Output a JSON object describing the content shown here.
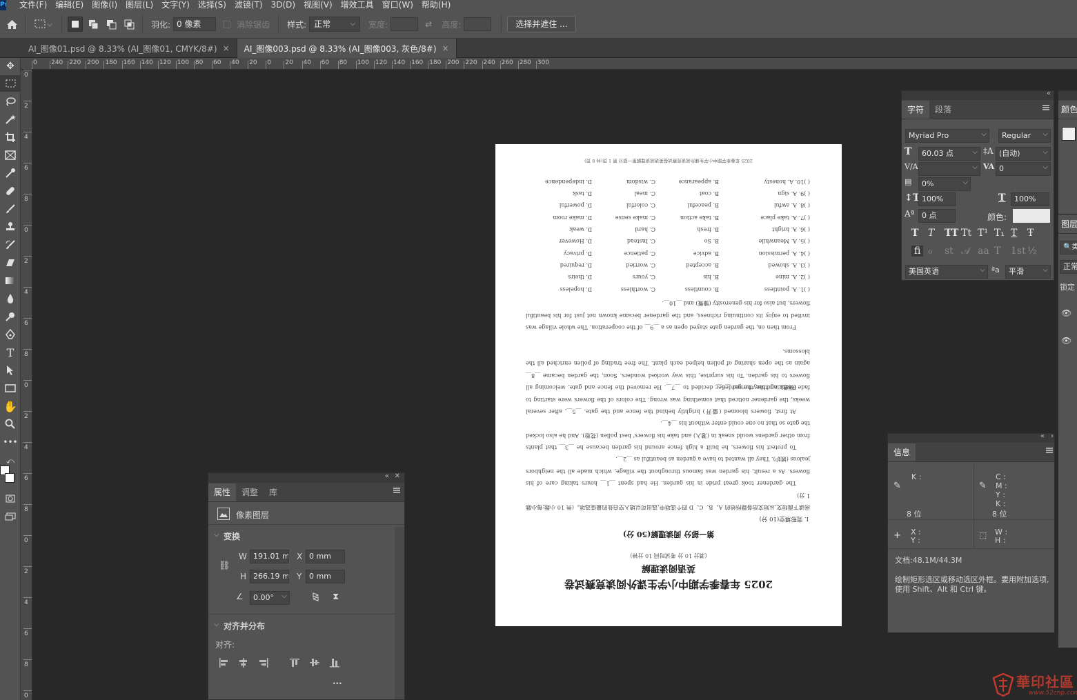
{
  "menubar": {
    "items": [
      "文件(F)",
      "编辑(E)",
      "图像(I)",
      "图层(L)",
      "文字(Y)",
      "选择(S)",
      "滤镜(T)",
      "3D(D)",
      "视图(V)",
      "增效工具",
      "窗口(W)",
      "帮助(H)"
    ]
  },
  "options_bar": {
    "feather_label": "羽化:",
    "feather_value": "0 像素",
    "antialias_label": "消除锯齿",
    "style_label": "样式:",
    "style_value": "正常",
    "width_label": "宽度:",
    "height_label": "高度:",
    "select_mask_button": "选择并遮住 ..."
  },
  "tabs": [
    {
      "label": "AI_图像01.psd @ 8.33% (AI_图像01, CMYK/8#)",
      "close": "×",
      "active": false
    },
    {
      "label": "AI_图像003.psd @ 8.33% (AI_图像003, 灰色/8#)",
      "close": "×",
      "active": true
    }
  ],
  "ruler_top_ticks": [
    "0",
    "240",
    "220",
    "200",
    "180",
    "160",
    "140",
    "120",
    "100",
    "80",
    "60",
    "40",
    "20",
    "0",
    "20",
    "40",
    "60",
    "80",
    "100",
    "120",
    "140",
    "160",
    "180",
    "200",
    "220",
    "240",
    "260",
    "280",
    "300"
  ],
  "ruler_left_ticks": [
    "0",
    "2",
    "4",
    "6",
    "8",
    "0",
    "2",
    "4",
    "6",
    "8",
    "0",
    "2",
    "4",
    "6",
    "8",
    "0",
    "2",
    "4",
    "6",
    "8",
    "0"
  ],
  "document": {
    "title": "2025 年春季学期中小学生课外阅读竞赛试卷",
    "subtitle": "英语阅读理解",
    "note": "(满分 10 分   考试时间 10 分钟)",
    "part": "第一部分   阅读理解(50 分)",
    "section": "I. 完形填空(10 分)",
    "para1": "阅读下面短文,从短文后各题所给的 A、B、C、D 四个选项中,选出可以填入空白处的最佳选项。(共 10 小题;每小题 1 分)",
    "para2": "The gardener took great pride in his garden. He had spent __1__ hours taking care of his flowers. As a result, his garden was famous throughout the village, which made all the neighbors jealous (嫉妒). They all wanted to have a garden as beautiful as __2__.",
    "para3": "To protect his flowers, he built a high fence around his garden because he __3__ that plants from other gardens would sneak in (潜入) and take his flowers' best pollen (花粉). And he also locked the gate so that no one could enter without his __4__.",
    "para4": "At first, flowers bloomed (盛开) brightly behind the fence and the gate. __5__, after several weeks, the gardener noticed that something was wrong. The colors of the flowers were starting to fade (褪色), and they turned __6__.",
    "para5": "Realizing this, the gardener decided to __7__. He removed the fence and gate, welcoming all flowers to his garden. To his surprise, this way worked wonders. Soon, the garden became __8__ again as the open sharing of pollen helped each plant. The free trading of pollen enriched all the blossoms.",
    "para6": "From then on, the garden gate stayed open as a __9__ of the cooperation. The whole village was invited to enjoy its continuing richness, and the gardener became known not just for his beautiful flowers, but also for his generosity (慷慨) and __10__.",
    "options": [
      [
        "( )1. A. pointless",
        "B. countless",
        "C. worthless",
        "D. hopeless"
      ],
      [
        "( )2. A. mine",
        "B. his",
        "C. yours",
        "D. theirs"
      ],
      [
        "( )3. A. showed",
        "B. accepted",
        "C. worried",
        "D. required"
      ],
      [
        "( )4. A. permission",
        "B. advice",
        "C. patience",
        "D. privacy"
      ],
      [
        "( )5. A. Meanwhile",
        "B. So",
        "C. Instead",
        "D. However"
      ],
      [
        "( )6. A. bright",
        "B. fresh",
        "C. hard",
        "D. weak"
      ],
      [
        "( )7. A. take place",
        "B. take action",
        "C. make sense",
        "D. make room"
      ],
      [
        "( )8. A. awful",
        "B. peaceful",
        "C. colorful",
        "D. powerful"
      ],
      [
        "( )9. A. sign",
        "B. coat",
        "C. meal",
        "D. task"
      ],
      [
        "( )10. A. honesty",
        "B. appearance",
        "C. wisdom",
        "D. independence"
      ]
    ],
    "header": "2025 年春季学期中小学生课外阅读竞赛试卷英语阅读理解第一部分   第 1 页(共 8 页)"
  },
  "properties_panel": {
    "tabs": [
      "属性",
      "调整",
      "库"
    ],
    "layer_type": "像素图层",
    "transform_heading": "变换",
    "w_label": "W",
    "w_value": "191.01 mm",
    "h_label": "H",
    "h_value": "266.19 mm",
    "x_label": "X",
    "x_value": "0 mm",
    "y_label": "Y",
    "y_value": "0 mm",
    "angle_value": "0.00°",
    "align_heading": "对齐并分布",
    "align_label": "对齐:",
    "more": "..."
  },
  "character_panel": {
    "tabs": [
      "字符",
      "段落"
    ],
    "font_family": "Myriad Pro",
    "font_style": "Regular",
    "font_size": "60.03 点",
    "leading": "(自动)",
    "tracking": "0",
    "tsume": "0%",
    "vscale": "100%",
    "hscale": "100%",
    "baseline": "0 点",
    "color_label": "颜色:",
    "language": "美国英语",
    "aa_label": "ªa",
    "antialias": "平滑",
    "style_glyphs": [
      "T",
      "T",
      "TT",
      "Tt",
      "T¹",
      "T₁",
      "T",
      "Ŧ"
    ],
    "ot_glyphs": [
      "fi",
      "ℴ",
      "st",
      "𝒜",
      "aa",
      "T",
      "1st",
      "½"
    ]
  },
  "color_panel": {
    "tab": "颜色"
  },
  "layers_panel": {
    "tab": "图层",
    "kind": "类",
    "blend": "正常",
    "lock": "锁定"
  },
  "info_panel": {
    "tab": "信息",
    "k_label": "K :",
    "c_label": "C :",
    "m_label": "M :",
    "y_label": "Y :",
    "k2_label": "K :",
    "bit_left": "8 位",
    "bit_right": "8 位",
    "x_label": "X :",
    "y2_label": "Y :",
    "w_label": "W :",
    "h_label": "H :",
    "doc_size": "文档:48.1M/44.3M",
    "hint": "绘制矩形选区或移动选区外框。要用附加选项,使用 Shift、Alt 和 Ctrl 键。"
  },
  "watermark": {
    "text": "華印社區",
    "url": "www.52cnp.com"
  }
}
